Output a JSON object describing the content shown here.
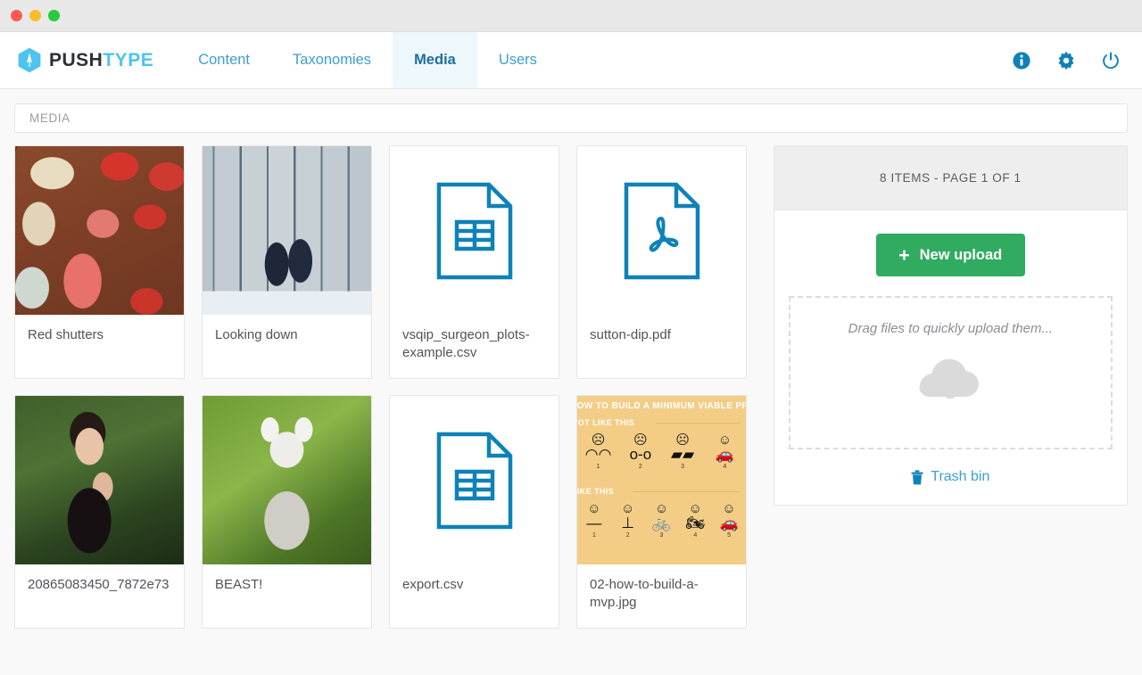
{
  "window": {
    "traffic_lights": [
      "close-button",
      "minimize-button",
      "maximize-button"
    ]
  },
  "brand": {
    "mark": "pushtype-hexagon-logo",
    "name_bold": "PUSH",
    "name_light": "TYPE",
    "color_bold": "#2b2f38",
    "color_light": "#4ec3ee"
  },
  "nav": {
    "items": [
      {
        "label": "Content",
        "active": false
      },
      {
        "label": "Taxonomies",
        "active": false
      },
      {
        "label": "Media",
        "active": true
      },
      {
        "label": "Users",
        "active": false
      }
    ],
    "icons": [
      {
        "name": "info-icon",
        "glyph": "i"
      },
      {
        "name": "gear-icon",
        "glyph": "settings"
      },
      {
        "name": "power-icon",
        "glyph": "power"
      }
    ],
    "link_color": "#3d9fd0",
    "active_bg": "#eef8fc",
    "icon_color": "#0e82b8"
  },
  "breadcrumb": {
    "items": [
      "MEDIA"
    ]
  },
  "media": {
    "items": [
      {
        "caption": "Red shutters",
        "kind": "photo-shutters",
        "nowrap": false
      },
      {
        "caption": "Looking down",
        "kind": "photo-lookingdown",
        "nowrap": false
      },
      {
        "caption": "vsqip_surgeon_plots-example.csv",
        "kind": "icon-csv",
        "nowrap": false
      },
      {
        "caption": "sutton-dip.pdf",
        "kind": "icon-pdf",
        "nowrap": false
      },
      {
        "caption": "20865083450_7872e73",
        "kind": "photo-portrait",
        "nowrap": true
      },
      {
        "caption": "BEAST!",
        "kind": "photo-lemur",
        "nowrap": false
      },
      {
        "caption": "export.csv",
        "kind": "icon-csv",
        "nowrap": false
      },
      {
        "caption": "02-how-to-build-a-mvp.jpg",
        "kind": "photo-mvp",
        "nowrap": false
      }
    ]
  },
  "mvp_thumb": {
    "title": "HOW TO BUILD A MINIMUM VIABLE PRODUCT",
    "sub_top": "NOT LIKE THIS",
    "sub_bottom": "LIKE THIS",
    "row_top": [
      {
        "face": "☹",
        "glyph": "◠◠",
        "num": "1"
      },
      {
        "face": "☹",
        "glyph": "o-o",
        "num": "2"
      },
      {
        "face": "☹",
        "glyph": "▰▰",
        "num": "3"
      },
      {
        "face": "☺",
        "glyph": "🚗",
        "num": "4"
      }
    ],
    "row_bottom": [
      {
        "face": "☺",
        "glyph": "—",
        "num": "1"
      },
      {
        "face": "☺",
        "glyph": "⊥",
        "num": "2"
      },
      {
        "face": "☺",
        "glyph": "🚲",
        "num": "3"
      },
      {
        "face": "☺",
        "glyph": "🏍",
        "num": "4"
      },
      {
        "face": "☺",
        "glyph": "🚗",
        "num": "5"
      }
    ],
    "bg_color": "#f3cd86"
  },
  "side_panel": {
    "count_label": "8 ITEMS - PAGE 1 OF 1",
    "upload_button": {
      "label": "New upload",
      "icon": "plus-icon",
      "color": "#31ab60"
    },
    "dropzone": {
      "text": "Drag files to quickly upload them...",
      "icon": "cloud-upload-icon"
    },
    "trash": {
      "label": "Trash bin",
      "icon": "trash-icon",
      "color": "#3d9fd0"
    }
  },
  "theme": {
    "page_bg": "#f9f9f9",
    "card_bg": "#ffffff",
    "border": "#e6e6e6",
    "text": "#52525a",
    "muted": "#9b9ba3",
    "file_icon_blue": "#0e82b8"
  }
}
